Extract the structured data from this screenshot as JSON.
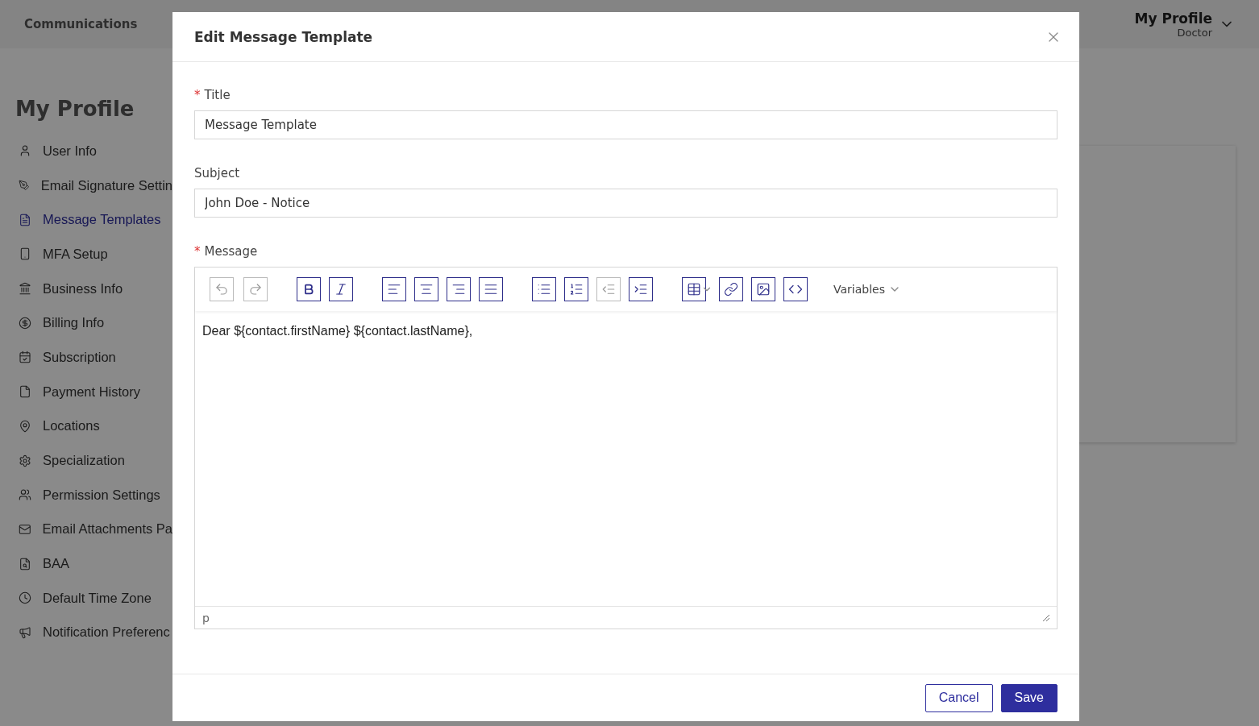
{
  "top_nav": {
    "items": [
      {
        "label": "Communications"
      }
    ],
    "profile": {
      "name": "My Profile",
      "role": "Doctor"
    }
  },
  "sidebar": {
    "title": "My Profile",
    "items": [
      {
        "kind": "user",
        "label": "User Info",
        "selected": false
      },
      {
        "kind": "signature",
        "label": "Email Signature Settin",
        "selected": false
      },
      {
        "kind": "document",
        "label": "Message Templates",
        "selected": true
      },
      {
        "kind": "phone",
        "label": "MFA Setup",
        "selected": false
      },
      {
        "kind": "bank",
        "label": "Business Info",
        "selected": false
      },
      {
        "kind": "dollar",
        "label": "Billing Info",
        "selected": false
      },
      {
        "kind": "calendar",
        "label": "Subscription",
        "selected": false
      },
      {
        "kind": "file",
        "label": "Payment History",
        "selected": false
      },
      {
        "kind": "pin",
        "label": "Locations",
        "selected": false
      },
      {
        "kind": "gear",
        "label": "Specialization",
        "selected": false
      },
      {
        "kind": "users",
        "label": "Permission Settings",
        "selected": false
      },
      {
        "kind": "mail",
        "label": "Email Attachments Pa",
        "selected": false
      },
      {
        "kind": "report",
        "label": "BAA",
        "selected": false
      },
      {
        "kind": "clock",
        "label": "Default Time Zone",
        "selected": false
      },
      {
        "kind": "megaphone",
        "label": "Notification Preferenc",
        "selected": false
      }
    ]
  },
  "modal": {
    "title": "Edit Message Template",
    "fields": [
      {
        "label": "Title",
        "required_mark": "*",
        "value": "Message Template"
      },
      {
        "label": "Subject",
        "value": "John Doe - Notice"
      }
    ],
    "message": {
      "label": "Message",
      "required_mark": "*",
      "toolbar": [
        {
          "kind": "undo",
          "disabled": true
        },
        {
          "kind": "redo",
          "disabled": true
        },
        {
          "kind": "bold",
          "disabled": false
        },
        {
          "kind": "italic",
          "disabled": false
        },
        {
          "kind": "align-left",
          "disabled": false
        },
        {
          "kind": "align-center",
          "disabled": false
        },
        {
          "kind": "align-right",
          "disabled": false
        },
        {
          "kind": "align-justify",
          "disabled": false
        },
        {
          "kind": "bullet-list",
          "disabled": false
        },
        {
          "kind": "numbered-list",
          "disabled": false
        },
        {
          "kind": "outdent",
          "disabled": true
        },
        {
          "kind": "indent",
          "disabled": false
        },
        {
          "kind": "table",
          "disabled": false
        },
        {
          "kind": "link",
          "disabled": false
        },
        {
          "kind": "image",
          "disabled": false
        },
        {
          "kind": "code",
          "disabled": false
        }
      ],
      "variables_label": "Variables",
      "content": "Dear ${contact.firstName} ${contact.lastName},",
      "status_path": "p"
    },
    "buttons": [
      {
        "kind": "secondary",
        "label": "Cancel"
      },
      {
        "kind": "primary",
        "label": "Save"
      }
    ]
  }
}
